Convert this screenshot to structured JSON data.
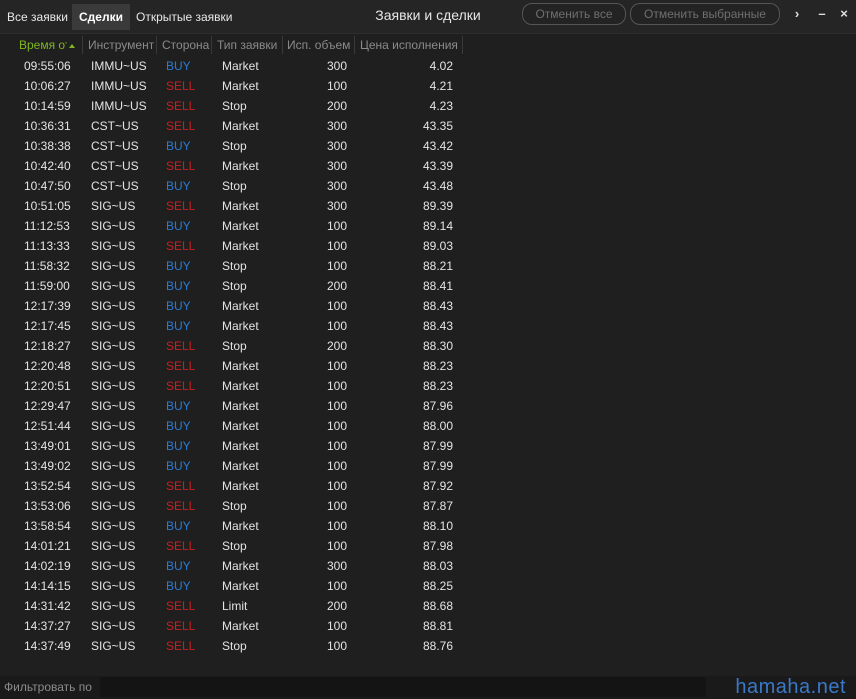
{
  "tabs": [
    {
      "label": "Все заявки"
    },
    {
      "label": "Сделки"
    },
    {
      "label": "Открытые заявки"
    }
  ],
  "title": "Заявки и сделки",
  "buttons": {
    "cancel_all": "Отменить все",
    "cancel_selected": "Отменить выбранные"
  },
  "window_controls": {
    "more": "›",
    "minimize": "–",
    "close": "×"
  },
  "columns": {
    "time": "Время от",
    "instrument": "Инструмент",
    "side": "Сторона",
    "type": "Тип заявки",
    "volume": "Исп. объем",
    "price": "Цена исполнения"
  },
  "colors": {
    "buy": "#2b7bd6",
    "sell": "#c82020",
    "sorted_header": "#7fb51f"
  },
  "trades": [
    {
      "time": "09:55:06",
      "instrument": "IMMU~US",
      "side": "BUY",
      "type": "Market",
      "volume": "300",
      "price": "4.02"
    },
    {
      "time": "10:06:27",
      "instrument": "IMMU~US",
      "side": "SELL",
      "type": "Market",
      "volume": "100",
      "price": "4.21"
    },
    {
      "time": "10:14:59",
      "instrument": "IMMU~US",
      "side": "SELL",
      "type": "Stop",
      "volume": "200",
      "price": "4.23"
    },
    {
      "time": "10:36:31",
      "instrument": "CST~US",
      "side": "SELL",
      "type": "Market",
      "volume": "300",
      "price": "43.35"
    },
    {
      "time": "10:38:38",
      "instrument": "CST~US",
      "side": "BUY",
      "type": "Stop",
      "volume": "300",
      "price": "43.42"
    },
    {
      "time": "10:42:40",
      "instrument": "CST~US",
      "side": "SELL",
      "type": "Market",
      "volume": "300",
      "price": "43.39"
    },
    {
      "time": "10:47:50",
      "instrument": "CST~US",
      "side": "BUY",
      "type": "Stop",
      "volume": "300",
      "price": "43.48"
    },
    {
      "time": "10:51:05",
      "instrument": "SIG~US",
      "side": "SELL",
      "type": "Market",
      "volume": "300",
      "price": "89.39"
    },
    {
      "time": "11:12:53",
      "instrument": "SIG~US",
      "side": "BUY",
      "type": "Market",
      "volume": "100",
      "price": "89.14"
    },
    {
      "time": "11:13:33",
      "instrument": "SIG~US",
      "side": "SELL",
      "type": "Market",
      "volume": "100",
      "price": "89.03"
    },
    {
      "time": "11:58:32",
      "instrument": "SIG~US",
      "side": "BUY",
      "type": "Stop",
      "volume": "100",
      "price": "88.21"
    },
    {
      "time": "11:59:00",
      "instrument": "SIG~US",
      "side": "BUY",
      "type": "Stop",
      "volume": "200",
      "price": "88.41"
    },
    {
      "time": "12:17:39",
      "instrument": "SIG~US",
      "side": "BUY",
      "type": "Market",
      "volume": "100",
      "price": "88.43"
    },
    {
      "time": "12:17:45",
      "instrument": "SIG~US",
      "side": "BUY",
      "type": "Market",
      "volume": "100",
      "price": "88.43"
    },
    {
      "time": "12:18:27",
      "instrument": "SIG~US",
      "side": "SELL",
      "type": "Stop",
      "volume": "200",
      "price": "88.30"
    },
    {
      "time": "12:20:48",
      "instrument": "SIG~US",
      "side": "SELL",
      "type": "Market",
      "volume": "100",
      "price": "88.23"
    },
    {
      "time": "12:20:51",
      "instrument": "SIG~US",
      "side": "SELL",
      "type": "Market",
      "volume": "100",
      "price": "88.23"
    },
    {
      "time": "12:29:47",
      "instrument": "SIG~US",
      "side": "BUY",
      "type": "Market",
      "volume": "100",
      "price": "87.96"
    },
    {
      "time": "12:51:44",
      "instrument": "SIG~US",
      "side": "BUY",
      "type": "Market",
      "volume": "100",
      "price": "88.00"
    },
    {
      "time": "13:49:01",
      "instrument": "SIG~US",
      "side": "BUY",
      "type": "Market",
      "volume": "100",
      "price": "87.99"
    },
    {
      "time": "13:49:02",
      "instrument": "SIG~US",
      "side": "BUY",
      "type": "Market",
      "volume": "100",
      "price": "87.99"
    },
    {
      "time": "13:52:54",
      "instrument": "SIG~US",
      "side": "SELL",
      "type": "Market",
      "volume": "100",
      "price": "87.92"
    },
    {
      "time": "13:53:06",
      "instrument": "SIG~US",
      "side": "SELL",
      "type": "Stop",
      "volume": "100",
      "price": "87.87"
    },
    {
      "time": "13:58:54",
      "instrument": "SIG~US",
      "side": "BUY",
      "type": "Market",
      "volume": "100",
      "price": "88.10"
    },
    {
      "time": "14:01:21",
      "instrument": "SIG~US",
      "side": "SELL",
      "type": "Stop",
      "volume": "100",
      "price": "87.98"
    },
    {
      "time": "14:02:19",
      "instrument": "SIG~US",
      "side": "BUY",
      "type": "Market",
      "volume": "300",
      "price": "88.03"
    },
    {
      "time": "14:14:15",
      "instrument": "SIG~US",
      "side": "BUY",
      "type": "Market",
      "volume": "100",
      "price": "88.25"
    },
    {
      "time": "14:31:42",
      "instrument": "SIG~US",
      "side": "SELL",
      "type": "Limit",
      "volume": "200",
      "price": "88.68"
    },
    {
      "time": "14:37:27",
      "instrument": "SIG~US",
      "side": "SELL",
      "type": "Market",
      "volume": "100",
      "price": "88.81"
    },
    {
      "time": "14:37:49",
      "instrument": "SIG~US",
      "side": "SELL",
      "type": "Stop",
      "volume": "100",
      "price": "88.76"
    }
  ],
  "filter": {
    "label": "Фильтровать по",
    "value": ""
  },
  "watermark": "hamaha.net"
}
